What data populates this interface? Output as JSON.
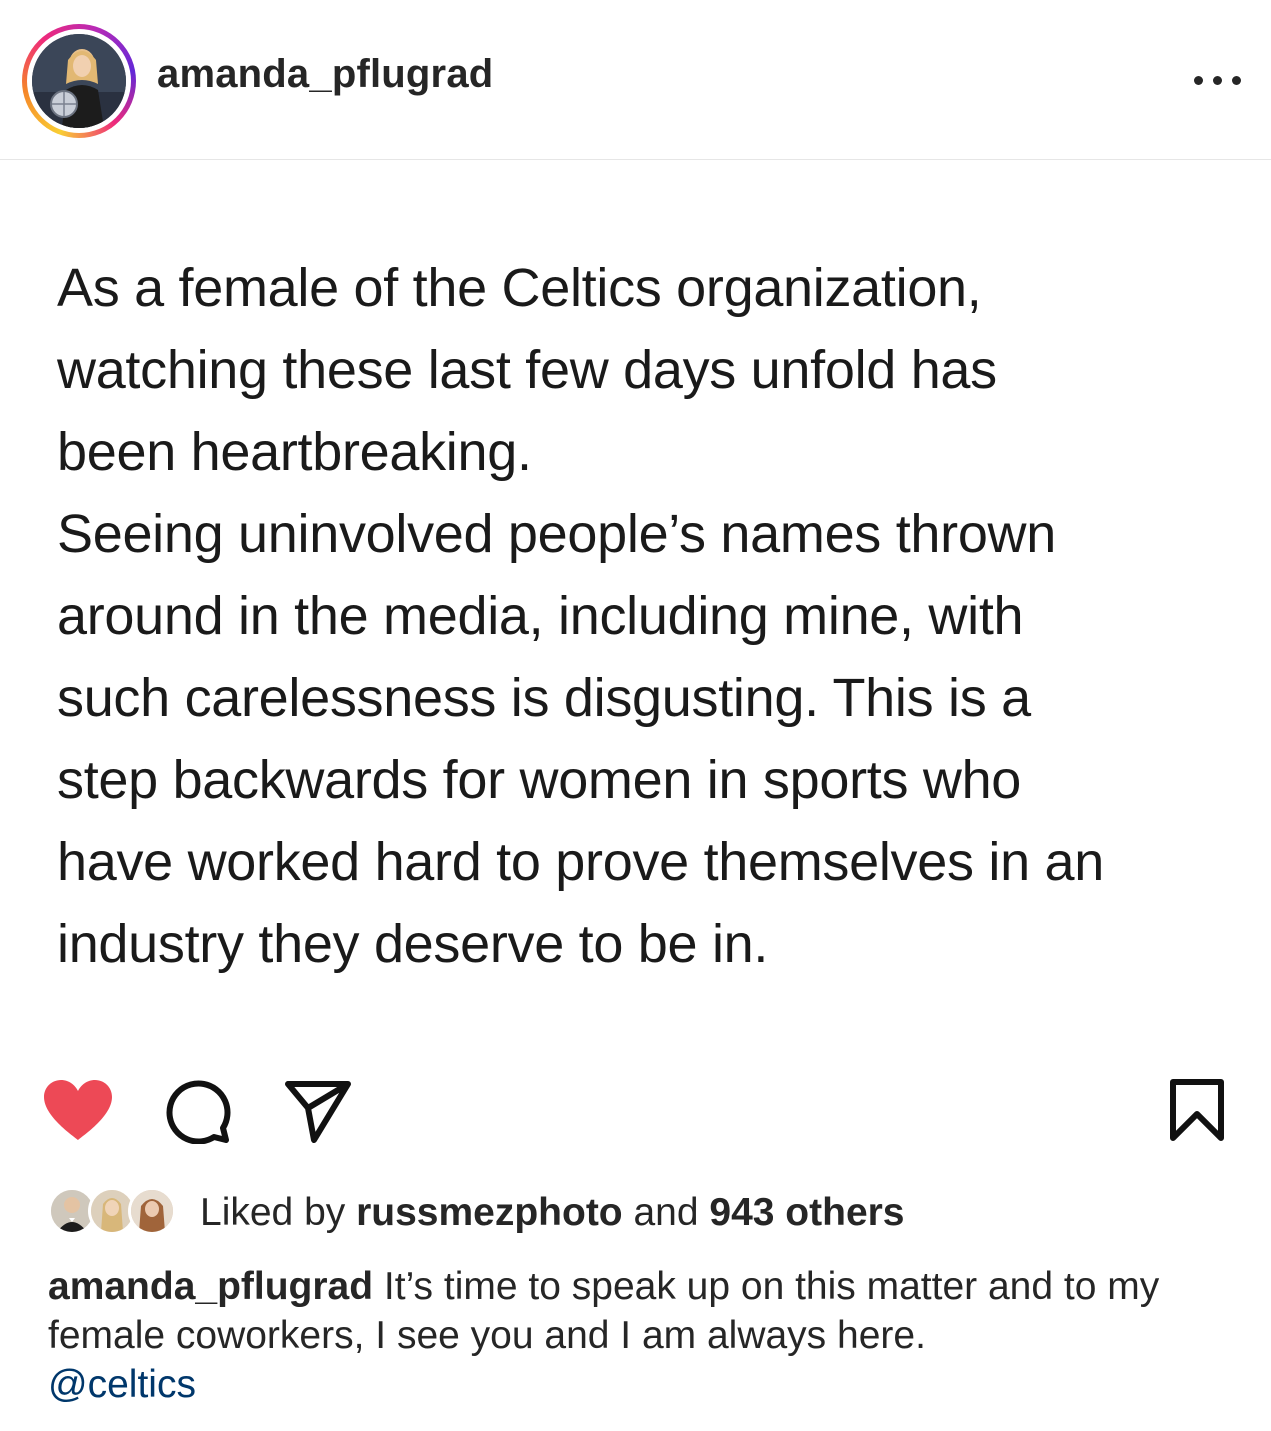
{
  "header": {
    "username": "amanda_pflugrad",
    "more_icon": "more-horizontal-icon"
  },
  "post": {
    "text": "As a female of the Celtics organization,\nwatching these last few days unfold has\nbeen heartbreaking.\nSeeing uninvolved people’s names thrown\naround in the media, including mine, with\nsuch carelessness is disgusting. This is a\nstep backwards for women in sports who\nhave worked hard to prove themselves in an\nindustry they deserve to be in."
  },
  "actions": {
    "like_icon": "heart-filled-icon",
    "like_color": "#ed4956",
    "comment_icon": "comment-icon",
    "share_icon": "send-icon",
    "save_icon": "bookmark-icon"
  },
  "likes": {
    "prefix": "Liked by",
    "user": "russmezphoto",
    "joiner": "and",
    "others": "943 others"
  },
  "caption": {
    "username": "amanda_pflugrad",
    "text": "It’s time to speak up on this matter and to my female coworkers, I see you and I am always here.",
    "mention": "@celtics",
    "mention_color": "#00376b"
  }
}
